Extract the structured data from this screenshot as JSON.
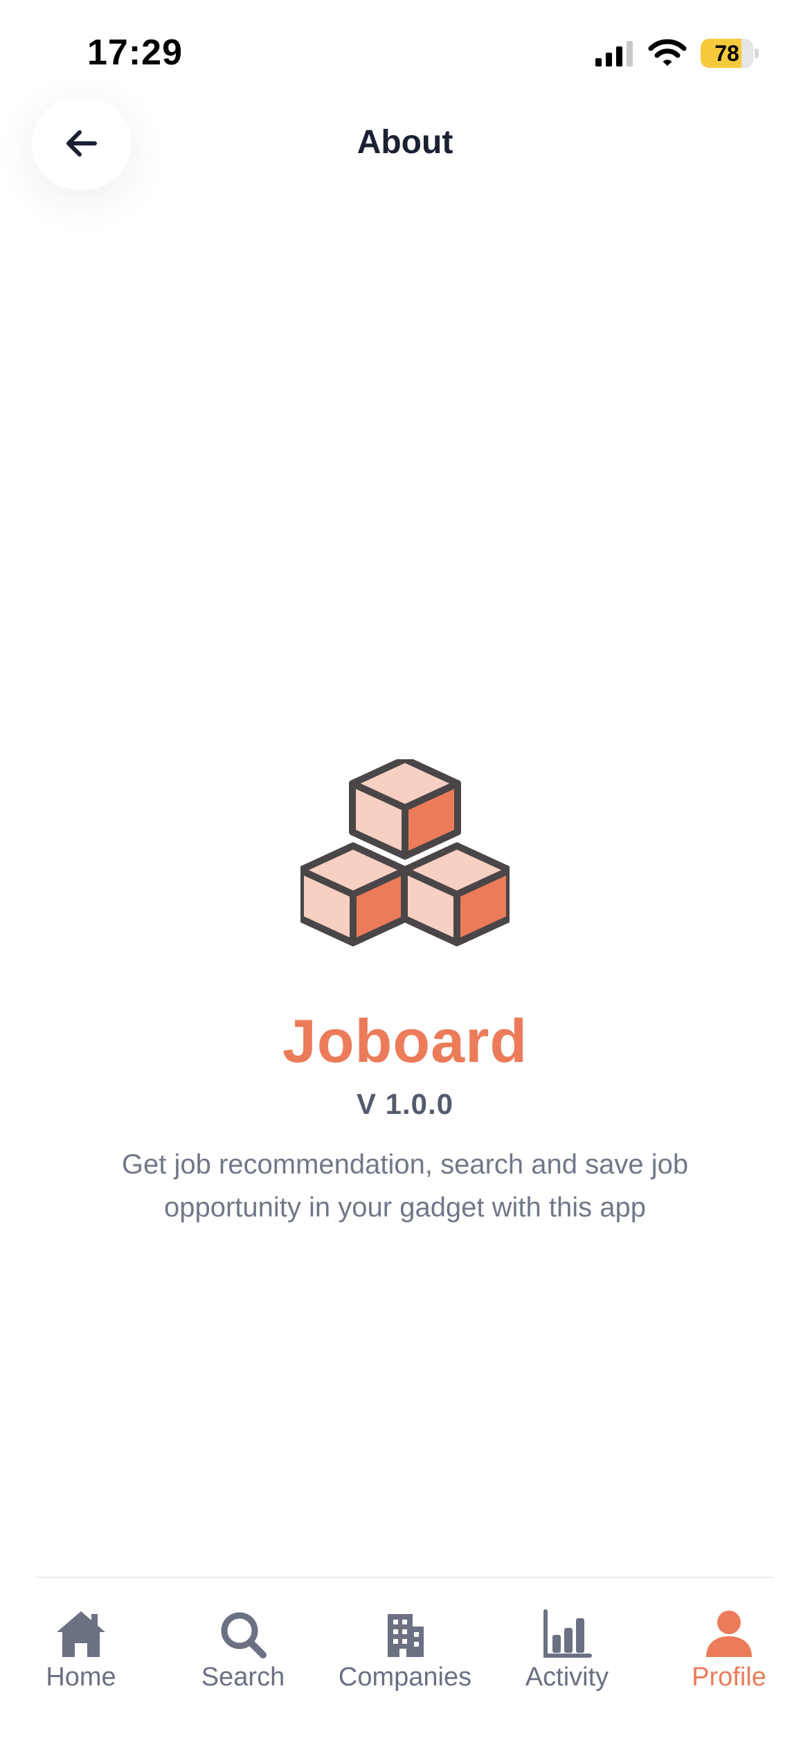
{
  "status_bar": {
    "time": "17:29",
    "battery_level": "78",
    "battery_fraction": 0.78,
    "battery_color": "#f6ca3c"
  },
  "header": {
    "title": "About",
    "back_icon": "arrow-left-icon"
  },
  "about": {
    "logo_icon": "stacked-cubes-icon",
    "app_name": "Joboard",
    "version": "V 1.0.0",
    "description": "Get job recommendation, search and save job opportunity in your gadget with this app"
  },
  "tab_bar": {
    "active_color": "#ec7b5a",
    "inactive_color": "#6b7083",
    "tabs": [
      {
        "label": "Home",
        "icon": "home-icon",
        "active": false
      },
      {
        "label": "Search",
        "icon": "search-icon",
        "active": false
      },
      {
        "label": "Companies",
        "icon": "building-icon",
        "active": false
      },
      {
        "label": "Activity",
        "icon": "bar-chart-icon",
        "active": false
      },
      {
        "label": "Profile",
        "icon": "person-icon",
        "active": true
      }
    ]
  },
  "colors": {
    "brand": "#ec7b5a",
    "brand_light": "#f7cfc3",
    "outline": "#4a4647",
    "title_text": "#1b2033",
    "body_text": "#717788"
  }
}
